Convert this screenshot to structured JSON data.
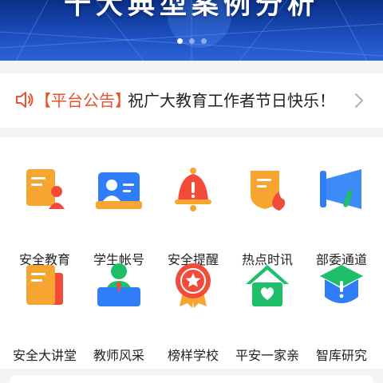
{
  "banner": {
    "title": "十大典型案例分析",
    "carousel_count": 3,
    "active_index": 0
  },
  "notice": {
    "icon": "speaker-icon",
    "tag": "【平台公告】",
    "text": "祝广大教育工作者节日快乐！",
    "tag_color": "#e8512b"
  },
  "grid": {
    "items": [
      {
        "label": "安全教育",
        "icon": "safety-education-icon"
      },
      {
        "label": "学生帐号",
        "icon": "student-account-icon"
      },
      {
        "label": "安全提醒",
        "icon": "safety-alert-bell-icon"
      },
      {
        "label": "热点时讯",
        "icon": "hot-news-icon"
      },
      {
        "label": "部委通道",
        "icon": "ministry-channel-megaphone-icon"
      },
      {
        "label": "安全大讲堂",
        "icon": "safety-lecture-icon"
      },
      {
        "label": "教师风采",
        "icon": "teacher-style-icon"
      },
      {
        "label": "榜样学校",
        "icon": "model-school-badge-icon"
      },
      {
        "label": "平安一家亲",
        "icon": "peaceful-family-house-icon"
      },
      {
        "label": "智库研究",
        "icon": "think-tank-research-icon"
      }
    ]
  },
  "colors": {
    "banner_dark": "#0a2f86",
    "accent_orange": "#f7a531",
    "accent_blue": "#2f7ef7",
    "accent_red": "#f24b3a",
    "accent_green": "#1fbf6a"
  }
}
